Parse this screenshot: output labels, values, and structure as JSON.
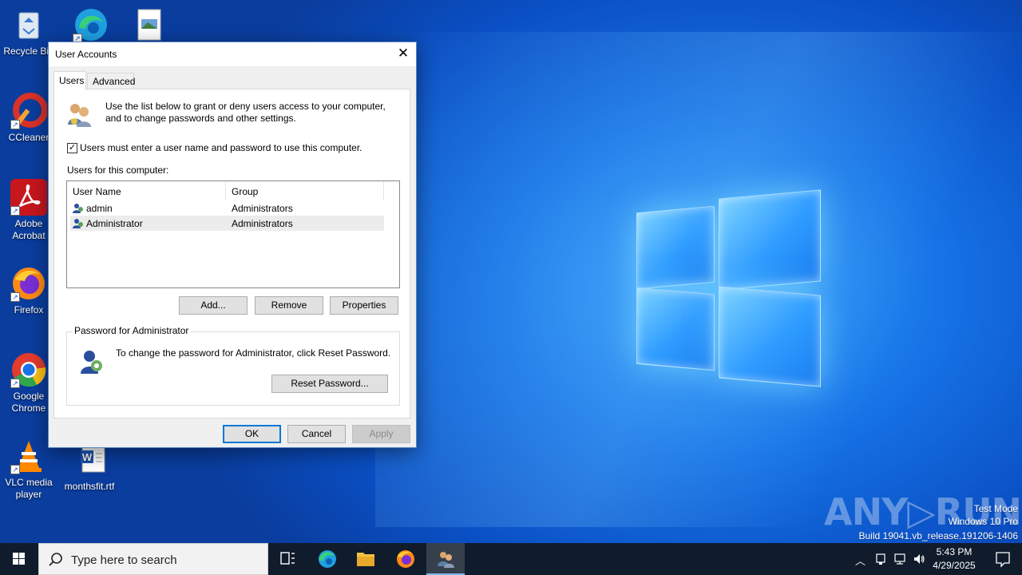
{
  "desktop": {
    "icons": [
      {
        "label": "Recycle Bin"
      },
      {
        "label": "CCleaner"
      },
      {
        "label": "Adobe Acrobat"
      },
      {
        "label": "Firefox"
      },
      {
        "label": "Google Chrome"
      },
      {
        "label": "VLC media player"
      },
      {
        "label": "monthsfit.rtf"
      }
    ]
  },
  "dialog": {
    "title": "User Accounts",
    "tabs": [
      {
        "label": "Users"
      },
      {
        "label": "Advanced"
      }
    ],
    "intro": "Use the list below to grant or deny users access to your computer, and to change passwords and other settings.",
    "must_login_label": "Users must enter a user name and password to use this computer.",
    "must_login_checked": true,
    "list_label": "Users for this computer:",
    "columns": [
      "User Name",
      "Group"
    ],
    "rows": [
      {
        "name": "admin",
        "group": "Administrators"
      },
      {
        "name": "Administrator",
        "group": "Administrators"
      }
    ],
    "buttons": {
      "add": "Add...",
      "remove": "Remove",
      "properties": "Properties"
    },
    "password_group": {
      "legend": "Password for Administrator",
      "text": "To change the password for Administrator, click Reset Password.",
      "reset_button": "Reset Password..."
    },
    "footer": {
      "ok": "OK",
      "cancel": "Cancel",
      "apply": "Apply"
    }
  },
  "watermark": {
    "brand": "ANY.RUN",
    "line1": "Test Mode",
    "line2": "Windows 10 Pro",
    "line3": "Build 19041.vb_release.191206-1406"
  },
  "taskbar": {
    "search_placeholder": "Type here to search",
    "time": "5:43 PM",
    "date": "4/29/2025"
  },
  "colors": {
    "accent": "#0078d7",
    "taskbar": "#101c2c"
  }
}
